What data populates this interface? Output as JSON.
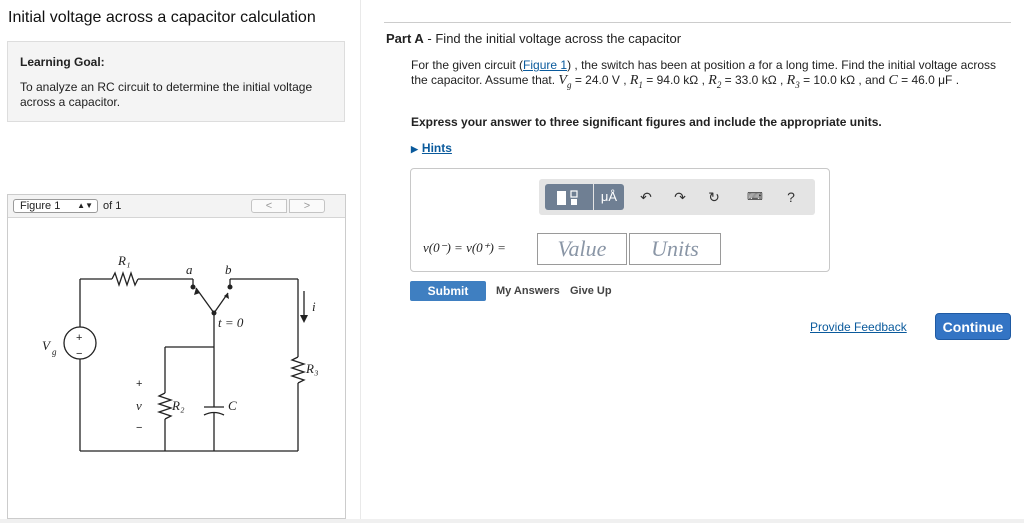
{
  "page": {
    "title": "Initial voltage across a capacitor calculation"
  },
  "learning_goal": {
    "title": "Learning Goal:",
    "text": "To analyze an RC circuit to determine the initial voltage across a capacitor."
  },
  "figure_panel": {
    "selected": "Figure 1",
    "of_label": "of 1",
    "prev_label": "<",
    "next_label": ">",
    "circuit_labels": {
      "r1": "R₁",
      "r2": "R₂",
      "r3": "R₃",
      "vg": "V",
      "vg_sub": "g",
      "c": "C",
      "a": "a",
      "b": "b",
      "t": "t = 0",
      "i": "i",
      "v": "v",
      "plus_src": "+",
      "minus_src": "−",
      "plus_v": "+",
      "minus_v": "−"
    }
  },
  "part": {
    "label": "Part A",
    "title": " - Find the initial voltage across the capacitor"
  },
  "problem": {
    "p1": "For the given circuit (",
    "fig_link": "Figure 1",
    "p2": ") , the switch has been at position ",
    "pos": "a",
    "p3": " for a long time. Find the initial voltage across the capacitor. Assume that. ",
    "p4": " = 24.0 V , ",
    "p5": " = 94.0 kΩ , ",
    "p6": " = 33.0 kΩ , ",
    "p7": " = 10.0 kΩ , and ",
    "p8": " = 46.0 μF ."
  },
  "instruction": "Express your answer to three significant figures and include the appropriate units.",
  "hints_label": "Hints",
  "answer": {
    "toolbar": {
      "units": "μÅ",
      "help": "?"
    },
    "equation": "v(0⁻) = v(0⁺) =",
    "value_placeholder": "Value",
    "units_placeholder": "Units"
  },
  "actions": {
    "submit": "Submit",
    "my_answers": "My Answers",
    "give_up": "Give Up",
    "feedback": "Provide Feedback",
    "continue": "Continue"
  },
  "icons": {
    "template": "template-icon",
    "undo": "undo-icon",
    "redo": "redo-icon",
    "reset": "reset-icon",
    "keyboard": "keyboard-icon"
  }
}
